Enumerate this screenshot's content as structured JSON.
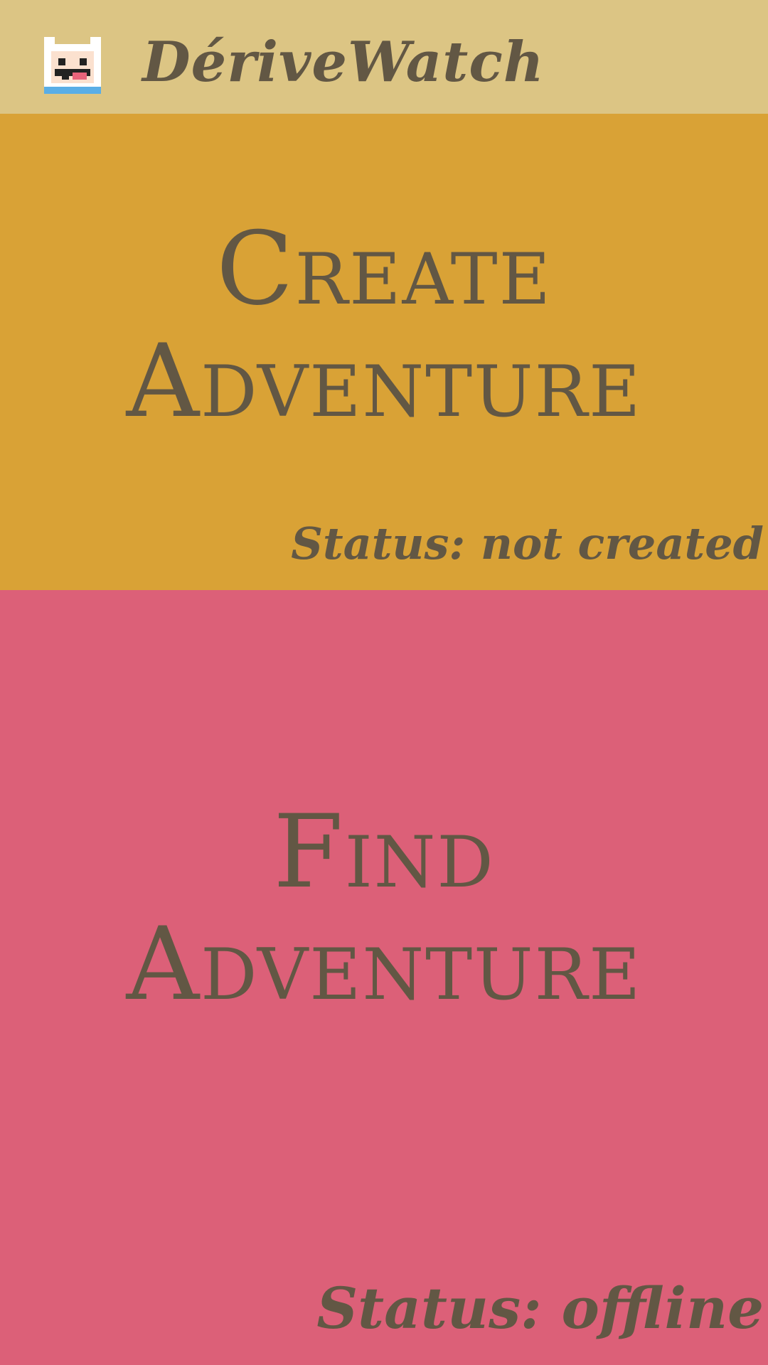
{
  "app_bar": {
    "title": "DériveWatch",
    "icon": "finn-character-icon"
  },
  "create_panel": {
    "title_line1": "Create",
    "title_line2": "Adventure",
    "status": "Status: not created",
    "color": "#d9a236"
  },
  "find_panel": {
    "title_line1": "Find",
    "title_line2": "Adventure",
    "status": "Status: offline",
    "color": "#dc6078"
  },
  "colors": {
    "app_bar_bg": "#dcc584",
    "text": "#625744"
  }
}
